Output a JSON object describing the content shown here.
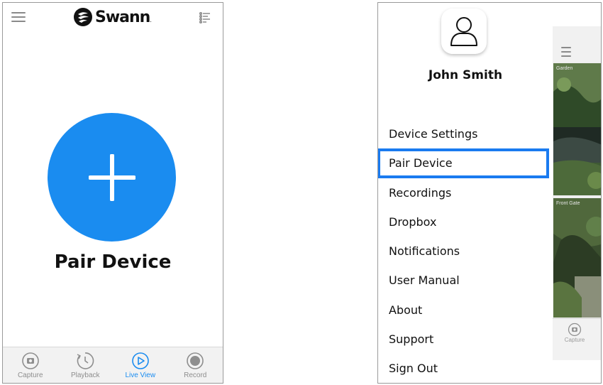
{
  "left_screen": {
    "logo_text": "Swann",
    "logo_mark": ".",
    "pair_title": "Pair Device",
    "tabs": [
      {
        "label": "Capture",
        "icon": "capture-icon",
        "active": false
      },
      {
        "label": "Playback",
        "icon": "playback-icon",
        "active": false
      },
      {
        "label": "Live View",
        "icon": "live-view-icon",
        "active": true
      },
      {
        "label": "Record",
        "icon": "record-icon",
        "active": false
      }
    ]
  },
  "right_screen": {
    "user_name": "John Smith",
    "menu": [
      {
        "label": "Device Settings"
      },
      {
        "label": "Pair Device"
      },
      {
        "label": "Recordings"
      },
      {
        "label": "Dropbox"
      },
      {
        "label": "Notifications"
      },
      {
        "label": "User Manual"
      },
      {
        "label": "About"
      },
      {
        "label": "Support"
      },
      {
        "label": "Sign Out"
      }
    ],
    "background": {
      "cameras": [
        {
          "label": "Garden"
        },
        {
          "label": "Front Gate"
        }
      ],
      "tab_label": "Capture"
    }
  },
  "colors": {
    "accent": "#1a8cf0",
    "highlight_border": "#1a7bf0",
    "tab_inactive": "#8e8e8e"
  }
}
